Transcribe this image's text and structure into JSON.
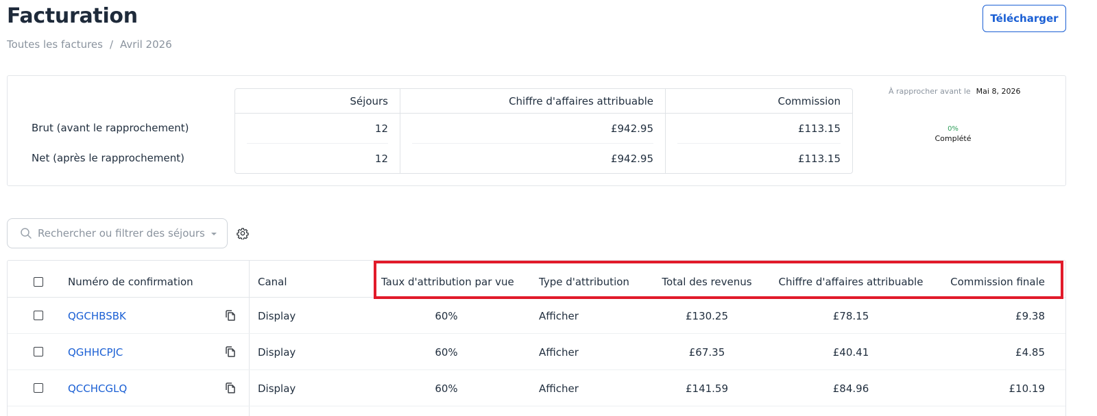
{
  "header": {
    "title": "Facturation",
    "breadcrumb": [
      "Toutes les factures",
      "/",
      "Avril 2026"
    ],
    "download_label": "Télécharger"
  },
  "summary": {
    "columns": [
      "Séjours",
      "Chiffre d'affaires attribuable",
      "Commission"
    ],
    "rows": [
      {
        "label": "Brut (avant le rapprochement)",
        "stays": "12",
        "revenue": "£942.95",
        "commission": "£113.15"
      },
      {
        "label": "Net (après le rapprochement)",
        "stays": "12",
        "revenue": "£942.95",
        "commission": "£113.15"
      }
    ],
    "reconcile_label": "À rapprocher avant le",
    "reconcile_date": "Mai 8, 2026",
    "progress_percent": "0%",
    "progress_label": "Complété",
    "progress_color": "#2e9e5a"
  },
  "search": {
    "placeholder": "Rechercher ou filtrer des séjours"
  },
  "table": {
    "headers": {
      "confirmation": "Numéro de confirmation",
      "channel": "Canal",
      "view_rate": "Taux d'attribution par vue",
      "type": "Type d'attribution",
      "total": "Total des revenus",
      "attributable": "Chiffre d'affaires attribuable",
      "commission": "Commission finale"
    },
    "rows": [
      {
        "confirmation": "QGCHBSBK",
        "channel": "Display",
        "view_rate": "60%",
        "type": "Afficher",
        "total": "£130.25",
        "attributable": "£78.15",
        "commission": "£9.38"
      },
      {
        "confirmation": "QGHHCPJC",
        "channel": "Display",
        "view_rate": "60%",
        "type": "Afficher",
        "total": "£67.35",
        "attributable": "£40.41",
        "commission": "£4.85"
      },
      {
        "confirmation": "QCCHCGLQ",
        "channel": "Display",
        "view_rate": "60%",
        "type": "Afficher",
        "total": "£141.59",
        "attributable": "£84.96",
        "commission": "£10.19"
      }
    ]
  },
  "colors": {
    "accent": "#1a5fd4",
    "highlight": "#e11a2a"
  }
}
